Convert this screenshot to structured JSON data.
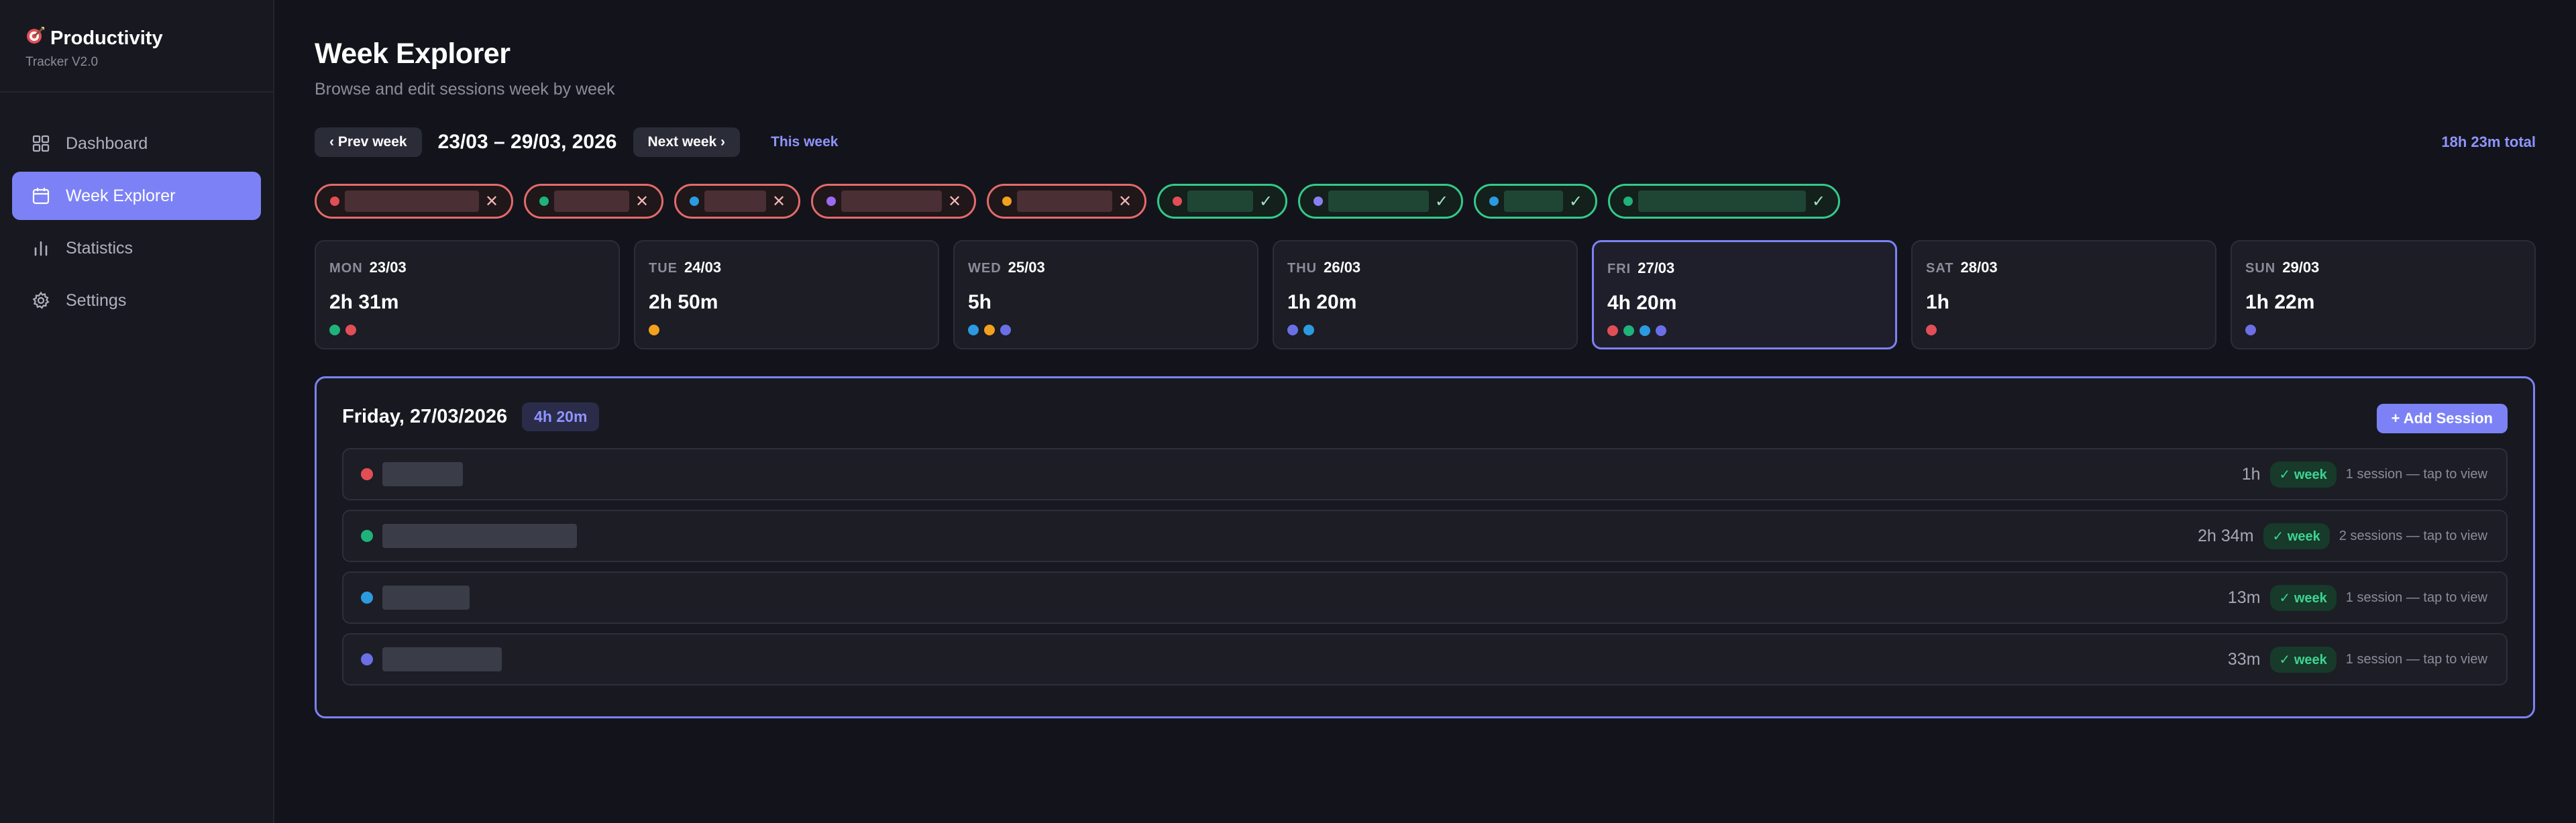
{
  "brand": {
    "title": "Productivity",
    "subtitle": "Tracker V2.0"
  },
  "sidebar": {
    "items": [
      {
        "label": "Dashboard",
        "icon": "grid-icon",
        "active": false
      },
      {
        "label": "Week Explorer",
        "icon": "calendar-icon",
        "active": true
      },
      {
        "label": "Statistics",
        "icon": "bar-chart-icon",
        "active": false
      },
      {
        "label": "Settings",
        "icon": "gear-icon",
        "active": false
      }
    ]
  },
  "header": {
    "title": "Week Explorer",
    "subtitle": "Browse and edit sessions week by week"
  },
  "toolbar": {
    "prev_label": "‹ Prev week",
    "range": "23/03 – 29/03, 2026",
    "next_label": "Next week ›",
    "this_week_label": "This week",
    "total": "18h 23m total"
  },
  "filters": [
    {
      "state": "excluded",
      "color": "#e24e56",
      "mark": "✕"
    },
    {
      "state": "excluded",
      "color": "#1fb27a",
      "mark": "✕"
    },
    {
      "state": "excluded",
      "color": "#2c9ae0",
      "mark": "✕"
    },
    {
      "state": "excluded",
      "color": "#9b6af0",
      "mark": "✕"
    },
    {
      "state": "excluded",
      "color": "#f2a01d",
      "mark": "✕"
    },
    {
      "state": "included",
      "color": "#e24e56",
      "mark": "✓"
    },
    {
      "state": "included",
      "color": "#8a7ff0",
      "mark": "✓"
    },
    {
      "state": "included",
      "color": "#2c9ae0",
      "mark": "✓"
    },
    {
      "state": "included",
      "color": "#1fb27a",
      "mark": "✓"
    }
  ],
  "days": [
    {
      "name": "MON",
      "date": "23/03",
      "duration": "2h 31m",
      "dots": [
        "#1fb27a",
        "#e24e56"
      ],
      "selected": false
    },
    {
      "name": "TUE",
      "date": "24/03",
      "duration": "2h 50m",
      "dots": [
        "#f2a01d"
      ],
      "selected": false
    },
    {
      "name": "WED",
      "date": "25/03",
      "duration": "5h",
      "dots": [
        "#2c9ae0",
        "#f2a01d",
        "#6b6fe6"
      ],
      "selected": false
    },
    {
      "name": "THU",
      "date": "26/03",
      "duration": "1h 20m",
      "dots": [
        "#6b6fe6",
        "#2c9ae0"
      ],
      "selected": false
    },
    {
      "name": "FRI",
      "date": "27/03",
      "duration": "4h 20m",
      "dots": [
        "#e24e56",
        "#1fb27a",
        "#2c9ae0",
        "#6b6fe6"
      ],
      "selected": true
    },
    {
      "name": "SAT",
      "date": "28/03",
      "duration": "1h",
      "dots": [
        "#e24e56"
      ],
      "selected": false
    },
    {
      "name": "SUN",
      "date": "29/03",
      "duration": "1h 22m",
      "dots": [
        "#6b6fe6"
      ],
      "selected": false
    }
  ],
  "detail": {
    "title": "Friday, 27/03/2026",
    "badge": "4h 20m",
    "add_label": "+ Add Session",
    "sessions": [
      {
        "color": "#e24e56",
        "duration": "1h",
        "tag": "✓ week",
        "count": "1 session — tap to view"
      },
      {
        "color": "#1fb27a",
        "duration": "2h 34m",
        "tag": "✓ week",
        "count": "2 sessions — tap to view"
      },
      {
        "color": "#2c9ae0",
        "duration": "13m",
        "tag": "✓ week",
        "count": "1 session — tap to view"
      },
      {
        "color": "#6b6fe6",
        "duration": "33m",
        "tag": "✓ week",
        "count": "1 session — tap to view"
      }
    ]
  }
}
